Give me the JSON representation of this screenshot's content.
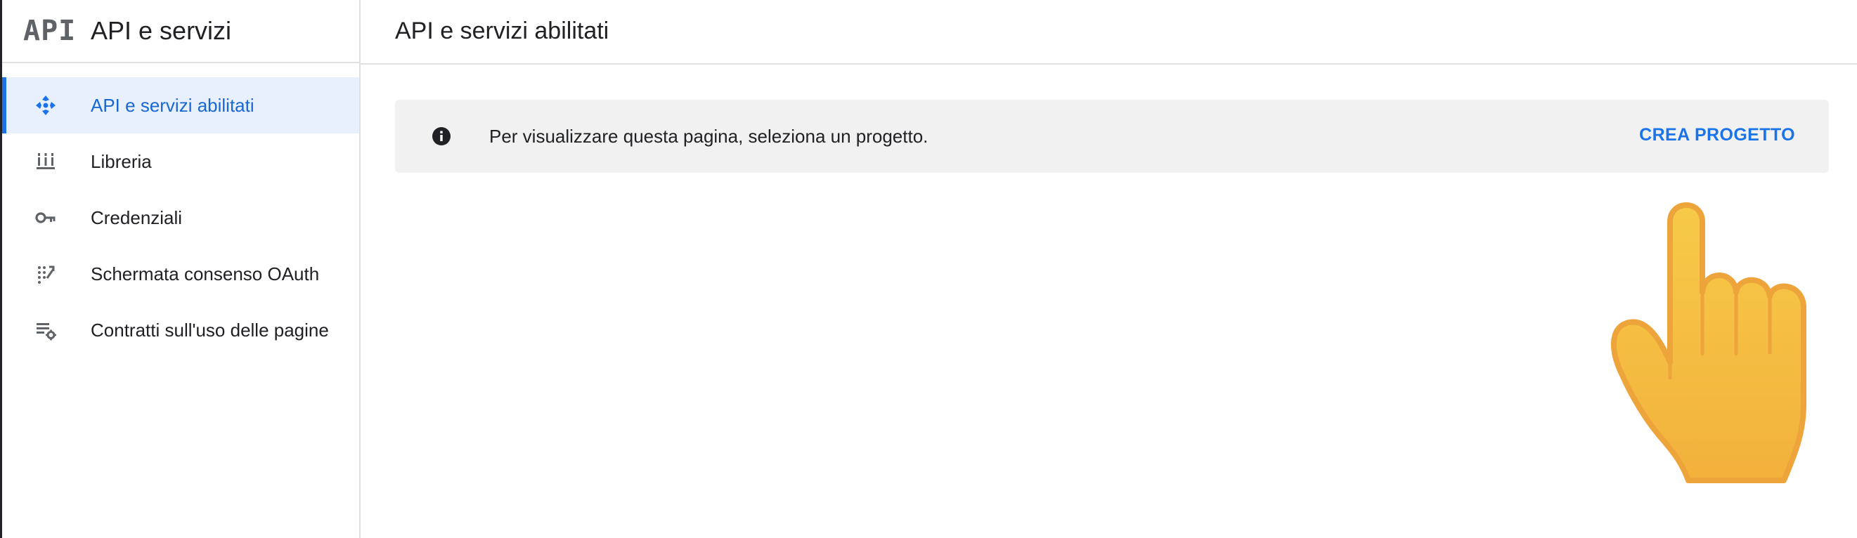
{
  "sidebar": {
    "logo_text": "API",
    "product_title": "API e servizi",
    "items": [
      {
        "label": "API e servizi abilitati",
        "icon": "api-diamond-icon",
        "active": true
      },
      {
        "label": "Libreria",
        "icon": "library-icon",
        "active": false
      },
      {
        "label": "Credenziali",
        "icon": "key-icon",
        "active": false
      },
      {
        "label": "Schermata consenso OAuth",
        "icon": "oauth-consent-icon",
        "active": false
      },
      {
        "label": "Contratti sull'uso delle pagine",
        "icon": "page-usage-agreements-icon",
        "active": false
      }
    ]
  },
  "main": {
    "title": "API e servizi abilitati",
    "banner": {
      "icon": "info-icon",
      "message": "Per visualizzare questa pagina, seleziona un progetto.",
      "action_label": "CREA PROGETTO"
    }
  },
  "overlay": {
    "icon": "pointing-hand-icon"
  },
  "colors": {
    "accent": "#1a73e8",
    "active_background": "#e8f0fe",
    "banner_background": "#f1f1f1",
    "hand_fill": "#f5c242",
    "hand_outline": "#eda53b"
  }
}
